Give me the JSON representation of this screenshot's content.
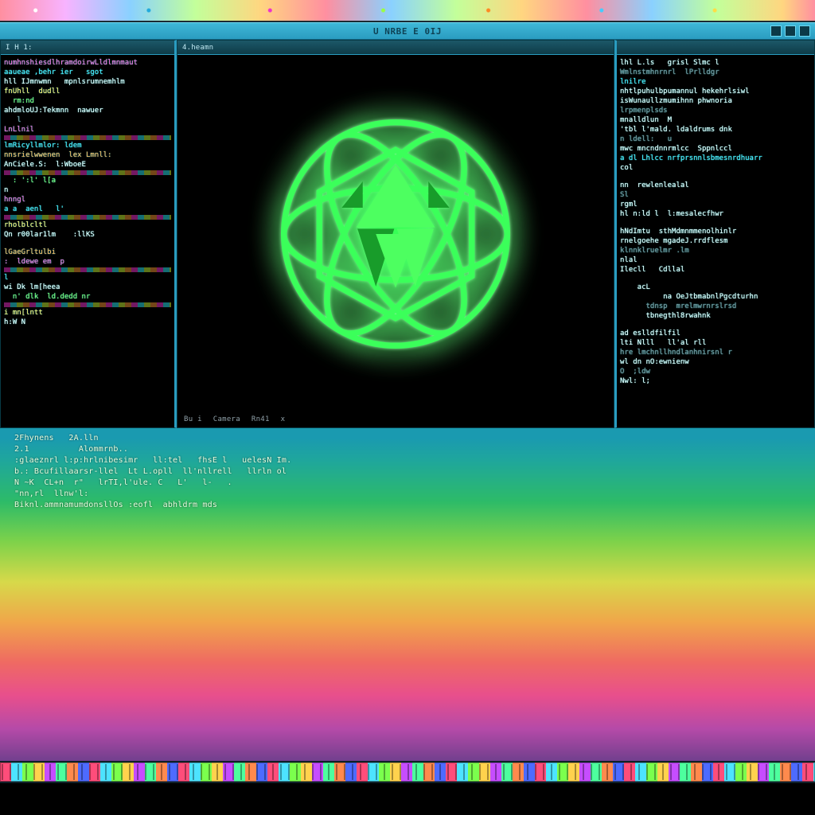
{
  "menubar": {},
  "window": {
    "title": "U NRBE  E 0IJ",
    "buttons": [
      "min",
      "max",
      "close"
    ]
  },
  "left_pane": {
    "tab": "I H  1:",
    "lines": [
      {
        "cls": "c-w",
        "t": ""
      },
      {
        "cls": "c-m",
        "t": "numhnshiesdlhramdoirwLldlmnmaut"
      },
      {
        "cls": "c-c",
        "t": "aaueae ,behr ier   sgot"
      },
      {
        "cls": "c-w",
        "t": "hll IJmnwmn   mpnlsrumnemhlm"
      },
      {
        "cls": "c-y",
        "t": "fnUhll  dudll"
      },
      {
        "cls": "c-g",
        "t": "  rm:nd"
      },
      {
        "cls": "c-w",
        "t": "ahdmloUJ:Tekmnn  nawuer"
      },
      {
        "cls": "c-d",
        "t": "   l"
      },
      {
        "cls": "c-m",
        "t": "LnLlnil"
      },
      {
        "cls": "tear",
        "t": ""
      },
      {
        "cls": "c-c",
        "t": "lmRicyllmlor: ldem"
      },
      {
        "cls": "c-o",
        "t": "nnsrielwwenen  lex Lmnll:"
      },
      {
        "cls": "c-w",
        "t": "AnCiele.S:  l:WboeE"
      },
      {
        "cls": "tear",
        "t": ""
      },
      {
        "cls": "c-g",
        "t": "  : ':l' l[a"
      },
      {
        "cls": "c-w",
        "t": "n"
      },
      {
        "cls": "c-m",
        "t": "hnngl"
      },
      {
        "cls": "c-c",
        "t": "a a  aenl   l'"
      },
      {
        "cls": "tear",
        "t": ""
      },
      {
        "cls": "c-y",
        "t": "rholblcltl"
      },
      {
        "cls": "c-w",
        "t": "Qn r00lar1lm    :llKS"
      },
      {
        "cls": "gap",
        "t": ""
      },
      {
        "cls": "c-o",
        "t": "lGaeGrltulbi"
      },
      {
        "cls": "c-m",
        "t": ":  ldewe em  p"
      },
      {
        "cls": "tear",
        "t": ""
      },
      {
        "cls": "c-c",
        "t": "l"
      },
      {
        "cls": "c-w",
        "t": "wi Dk lm[heea"
      },
      {
        "cls": "c-g",
        "t": "  n' dlk  ld.dedd nr"
      },
      {
        "cls": "tear",
        "t": ""
      },
      {
        "cls": "c-y",
        "t": "i mn[lntt"
      },
      {
        "cls": "c-w",
        "t": "h:W N"
      },
      {
        "cls": "gap",
        "t": ""
      }
    ]
  },
  "viewport": {
    "tab": "4.heamn",
    "status": [
      "Bu i",
      "Camera",
      "Rn41",
      "x"
    ]
  },
  "right_pane": {
    "tab": "",
    "lines": [
      {
        "cls": "c-w",
        "t": "lhl L.ls   grisl Slmc l"
      },
      {
        "cls": "c-d",
        "t": "Wmlnstmhnrnrl  lPrlldgr"
      },
      {
        "cls": "c-c",
        "t": "lnilre"
      },
      {
        "cls": "c-w",
        "t": "nhtlpuhulbpumannul hekehrlsiwl"
      },
      {
        "cls": "c-w",
        "t": "isWunaullzmumihnn phwnoria"
      },
      {
        "cls": "c-d",
        "t": "lrpmenplsds"
      },
      {
        "cls": "c-w",
        "t": "mnalldlun  M"
      },
      {
        "cls": "c-w",
        "t": "'tbl l'mald. ldaldrums dnk"
      },
      {
        "cls": "c-d",
        "t": "n ldell:   u"
      },
      {
        "cls": "c-w",
        "t": "mwc mncndnnrmlcc  Sppnlccl"
      },
      {
        "cls": "c-c",
        "t": "a dl Lhlcc nrfprsnnlsbmesnrdhuarr"
      },
      {
        "cls": "c-w",
        "t": "col"
      },
      {
        "cls": "gap",
        "t": ""
      },
      {
        "cls": "c-w",
        "t": "nn  rewlenlealal"
      },
      {
        "cls": "c-d",
        "t": "Sl"
      },
      {
        "cls": "c-w",
        "t": "rgml"
      },
      {
        "cls": "c-w",
        "t": "hl n:ld l  l:mesalecfhwr"
      },
      {
        "cls": "gap",
        "t": ""
      },
      {
        "cls": "c-w",
        "t": "hNdImtu  sthMdmnmmenolhinlr"
      },
      {
        "cls": "c-w",
        "t": "rnelgoehe mgadeJ.rrdflesm"
      },
      {
        "cls": "c-d",
        "t": "klnnklruelmr .lm"
      },
      {
        "cls": "c-w",
        "t": "nlal"
      },
      {
        "cls": "c-w",
        "t": "Ilecll   Cdllal"
      },
      {
        "cls": "gap",
        "t": ""
      },
      {
        "cls": "c-w",
        "t": "    acL"
      },
      {
        "cls": "c-w",
        "t": "          na OeJtbmabnlPgcdturhn"
      },
      {
        "cls": "c-d",
        "t": "      tdnsp  mrelmwrnrslrsd"
      },
      {
        "cls": "c-w",
        "t": "      tbnegthl8rwahnk"
      },
      {
        "cls": "gap",
        "t": ""
      },
      {
        "cls": "c-w",
        "t": "ad eslldfilfil"
      },
      {
        "cls": "c-w",
        "t": "lti Nlll   ll'al rll"
      },
      {
        "cls": "c-d",
        "t": "hre lmchnllhndlanhnirsnl r"
      },
      {
        "cls": "c-w",
        "t": "wl dn nO:ewnienw"
      },
      {
        "cls": "c-d",
        "t": "O  ;ldw"
      },
      {
        "cls": "c-w",
        "t": "Nwl: l;"
      }
    ]
  },
  "console": {
    "lines": [
      "2Fhynens   2A.lln",
      "2.1          Alommrnb..",
      ":glaeznrl l:p:hrlnibesimr   ll:tel   fhsE l   uelesN Im.",
      "b.: Bcufillaarsr-llel  Lt L.opll  ll'nllrell   llrln ol ",
      "N ~K  CL+n  r\"   lrTI,l'ule. C   L'   l-   .",
      "\"nn,rl  llnw'l:",
      "Biknl.ammnamumdonsllOs :eofl  abhldrm mds"
    ]
  }
}
